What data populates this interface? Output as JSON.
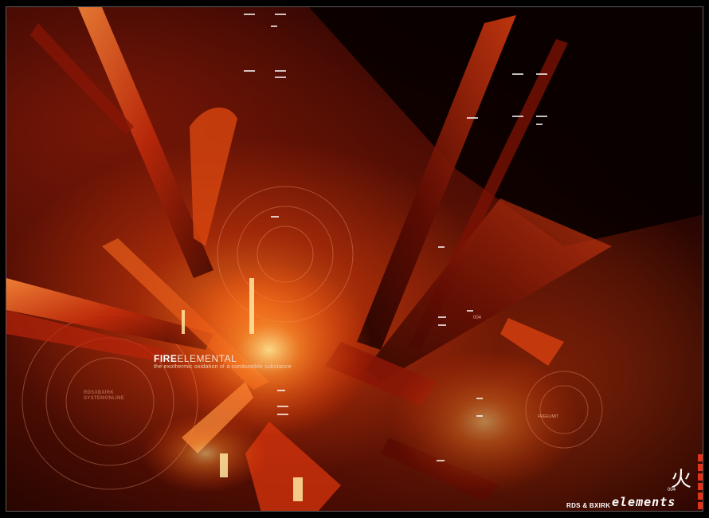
{
  "artwork": {
    "title_bold": "FIRE",
    "title_light": "ELEMENTAL",
    "subtitle": "the exothermic oxidation of a combustible substance",
    "system_line1": "RDSXBXIRK",
    "system_line2": "SYSTEMONLINE",
    "code_label": "004",
    "hud_label": "FREELIMIT",
    "credits": "RDS & BXIRK",
    "brand": "elements",
    "brand_number": "004",
    "kanji": "火"
  },
  "colors": {
    "accent": "#e0331a",
    "fire_core": "#ff7a1e",
    "fire_dark": "#6e1405",
    "background": "#000000"
  }
}
